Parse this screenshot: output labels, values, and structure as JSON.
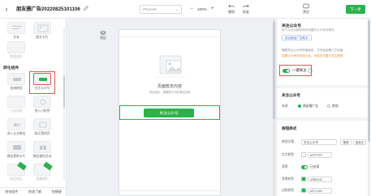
{
  "topbar": {
    "title": "朋友圈广告20220825101106",
    "device": {
      "selected": "iPhone8"
    },
    "zoom": {
      "minus": "−",
      "value": "100%",
      "plus": "+"
    },
    "undo_label": "撤销",
    "redo_label": "恢复",
    "preview_label": "预览",
    "next_label": "下一步"
  },
  "left_panel": {
    "row1": [
      {
        "label": "文本"
      },
      {
        "label": "图文卡片"
      }
    ],
    "row2": [
      {
        "label": "数据服务"
      }
    ],
    "section_label": "转化组件",
    "components": [
      {
        "label": "咨询按钮"
      },
      {
        "label": "关注公众号",
        "selected": true
      },
      {
        "label": "门店导航"
      },
      {
        "label": "进入小程序"
      },
      {
        "label": "进入企业微信"
      },
      {
        "label": "购买落地页"
      },
      {
        "label": "微信营销卡片"
      },
      {
        "label": "微信福利活动"
      },
      {
        "label": "商品购买"
      },
      {
        "label": "直播预约"
      }
    ],
    "bottom": {
      "tab1": "修饰组件",
      "tab2": "快速了解",
      "tab3": "快捷键"
    }
  },
  "canvas": {
    "layer_label": "图层",
    "empty_title": "页面暂无内容",
    "empty_sub": "添加组件，搭建属于你的落地页吧",
    "follow_button": "关注公众号"
  },
  "right_panel": {
    "title": "关注公众号",
    "subtitle": "用户点击后跳转到你设置的公众号详情页",
    "link_btn": "前往微信广告助手",
    "line1": "需要关注公众号的落地页，不可添加第三方页面",
    "line2": "如果公众号未完成认证，可能无法展示关注按钮",
    "one_key_follow": {
      "label": "一键关注",
      "enabled": true
    },
    "section_account": "关注公众号",
    "account_label": "来源",
    "account_opt1": "朋友圈广告",
    "account_opt2": "其他",
    "section_style": "按钮样式",
    "text_label": "按钮文案",
    "text_value": "关注公众号",
    "text_btn1": "常用",
    "text_btn2": "自定义",
    "font_color_label": "文字颜色",
    "font_color_value": "#FFFFFF",
    "bg_label": "背景",
    "bg_toggle_label": "已启用",
    "bg_color_label": "背景颜色",
    "bg_color_value": "#2BB24C",
    "border_label": "边框颜色",
    "border_value": "#07C160",
    "colors": {
      "accent": "#2bb24c",
      "highlight": "#e25555",
      "link": "#3a6fd8"
    }
  }
}
